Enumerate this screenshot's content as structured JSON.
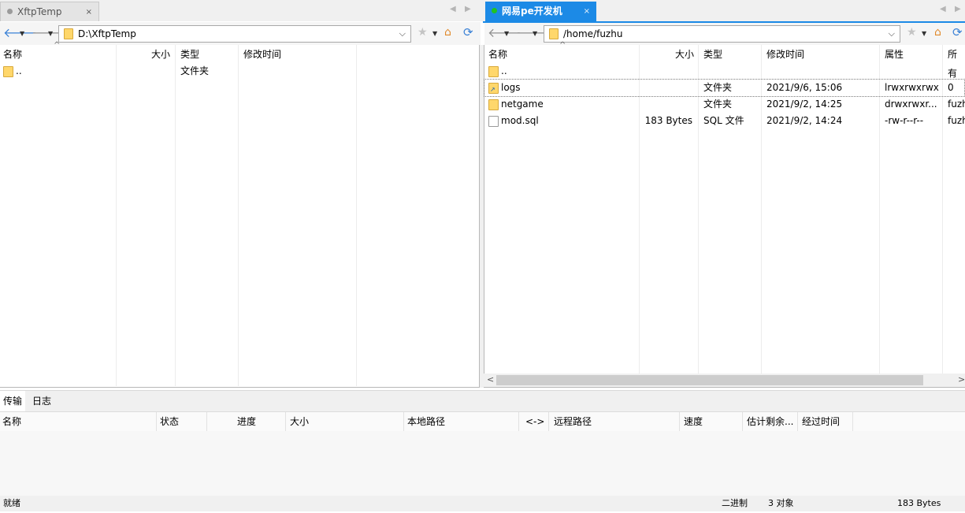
{
  "tabs": {
    "left": {
      "label": "XftpTemp",
      "close": "×"
    },
    "right": {
      "label": "网易pe开发机",
      "close": "×"
    },
    "nav_prev": "◀",
    "nav_next": "▶"
  },
  "left_panel": {
    "path": "D:\\XftpTemp",
    "columns": {
      "name": "名称",
      "size": "大小",
      "type": "类型",
      "modified": "修改时间"
    },
    "rows": [
      {
        "name": "..",
        "size": "",
        "type": "文件夹",
        "modified": ""
      }
    ]
  },
  "right_panel": {
    "path": "/home/fuzhu",
    "columns": {
      "name": "名称",
      "size": "大小",
      "type": "类型",
      "modified": "修改时间",
      "attr": "属性",
      "owner": "所有"
    },
    "rows": [
      {
        "name": "..",
        "size": "",
        "type": "",
        "modified": "",
        "attr": "",
        "owner": "",
        "icon": "folder"
      },
      {
        "name": "logs",
        "size": "",
        "type": "文件夹",
        "modified": "2021/9/6, 15:06",
        "attr": "lrwxrwxrwx",
        "owner": "0",
        "icon": "folder-link"
      },
      {
        "name": "netgame",
        "size": "",
        "type": "文件夹",
        "modified": "2021/9/2, 14:25",
        "attr": "drwxrwxr...",
        "owner": "fuzh",
        "icon": "folder"
      },
      {
        "name": "mod.sql",
        "size": "183 Bytes",
        "type": "SQL 文件",
        "modified": "2021/9/2, 14:24",
        "attr": "-rw-r--r--",
        "owner": "fuzh",
        "icon": "file"
      }
    ]
  },
  "bottom": {
    "tabs": {
      "transfer": "传输",
      "log": "日志"
    },
    "columns": {
      "name": "名称",
      "status": "状态",
      "progress": "进度",
      "size": "大小",
      "local": "本地路径",
      "dir": "<->",
      "remote": "远程路径",
      "speed": "速度",
      "eta": "估计剩余...",
      "elapsed": "经过时间"
    }
  },
  "status_bar": {
    "ready": "就绪",
    "mode": "二进制",
    "count": "3 对象",
    "size": "183 Bytes"
  },
  "colors": {
    "accent": "#1c8ae6",
    "folder": "#ffd76b",
    "online_dot": "#21c321"
  }
}
